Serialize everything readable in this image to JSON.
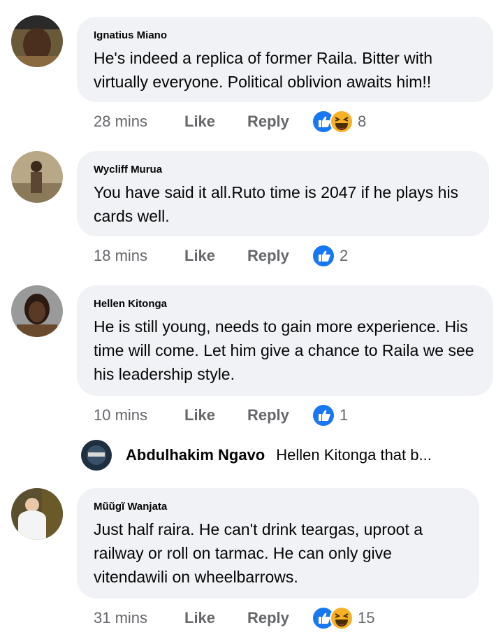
{
  "comments": [
    {
      "author": "Ignatius Miano",
      "text": "He's indeed a replica of former Raila. Bitter with virtually everyone.  Political oblivion awaits him!!",
      "time": "28 mins",
      "like_label": "Like",
      "reply_label": "Reply",
      "reaction_icons": [
        "like-icon",
        "haha-icon"
      ],
      "reaction_count": "8"
    },
    {
      "author": "Wycliff Murua",
      "text": "You have said it all.Ruto time is 2047 if he plays his cards well.",
      "time": "18 mins",
      "like_label": "Like",
      "reply_label": "Reply",
      "reaction_icons": [
        "like-icon"
      ],
      "reaction_count": "2"
    },
    {
      "author": "Hellen Kitonga",
      "text": "He is still young, needs to gain more experience. His time will come. Let him give a chance to Raila we see his leadership style.",
      "time": "10 mins",
      "like_label": "Like",
      "reply_label": "Reply",
      "reaction_icons": [
        "like-icon"
      ],
      "reaction_count": "1",
      "reply": {
        "author": "Abdulhakim Ngavo",
        "preview": "Hellen Kitonga that b..."
      }
    },
    {
      "author": "Mũũgĩ Wanjata",
      "text": "Just half raira. He can't drink teargas, uproot a railway or roll on tarmac. He can only give vitendawili on wheelbarrows.",
      "time": "31 mins",
      "like_label": "Like",
      "reply_label": "Reply",
      "reaction_icons": [
        "like-icon",
        "haha-icon"
      ],
      "reaction_count": "15"
    }
  ],
  "colors": {
    "bubble": "#f0f2f5",
    "like_blue": "#1877f2",
    "haha_yellow": "#f7b125",
    "meta_gray": "#65676b"
  }
}
